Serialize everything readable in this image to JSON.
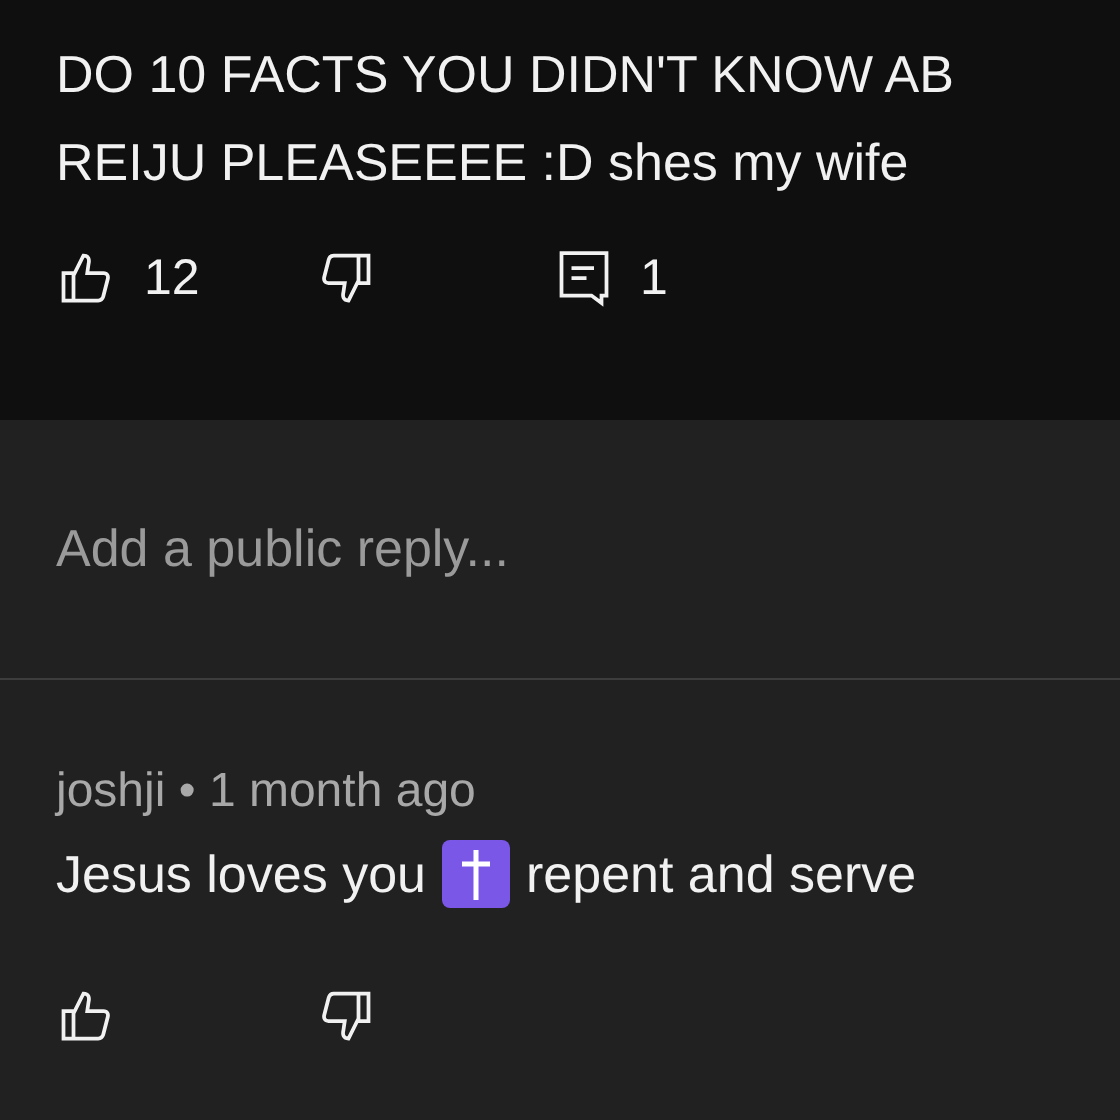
{
  "comment": {
    "lines": [
      "DO 10 FACTS YOU DIDN'T KNOW AB",
      "REIJU PLEASEEEE :D shes my wife"
    ],
    "likes": "12",
    "replies": "1"
  },
  "reply_field": {
    "placeholder": "Add a public reply..."
  },
  "reply": {
    "author": "joshji",
    "separator": "•",
    "time": "1 month ago",
    "text_before": "Jesus loves you",
    "text_after": "repent and serve"
  }
}
